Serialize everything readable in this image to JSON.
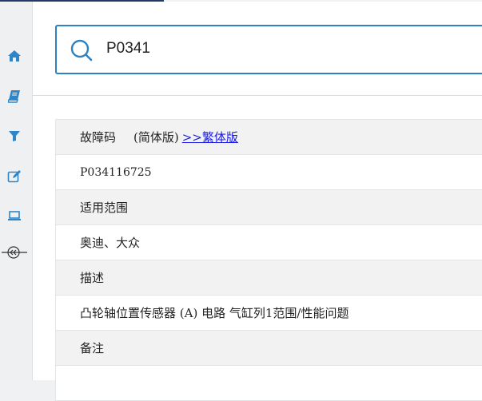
{
  "sidebar": {
    "items": [
      {
        "icon": "home-icon",
        "label": "home"
      },
      {
        "icon": "book-icon",
        "label": "book"
      },
      {
        "icon": "filter-icon",
        "label": "filter"
      },
      {
        "icon": "edit-icon",
        "label": "edit"
      },
      {
        "icon": "laptop-icon",
        "label": "laptop"
      }
    ],
    "collapse_icon": "collapse-icon"
  },
  "search": {
    "value": "P0341",
    "icon": "search-icon"
  },
  "detail": {
    "fault_code_label": "故障码",
    "variant_simplified": "(简体版)",
    "variant_traditional_link": ">>繁体版",
    "fault_code_value": "P034116725",
    "applicable_label": "适用范围",
    "applicable_value": "奥迪、大众",
    "description_label": "描述",
    "description_value": "凸轮轴位置传感器 (A) 电路 气缸列1范围/性能问题",
    "remarks_label": "备注"
  },
  "colors": {
    "accent": "#2e82c2",
    "sidebar_icon": "#2d86c9",
    "link": "#1a1ae6",
    "header_row": "#f2f2f2"
  }
}
